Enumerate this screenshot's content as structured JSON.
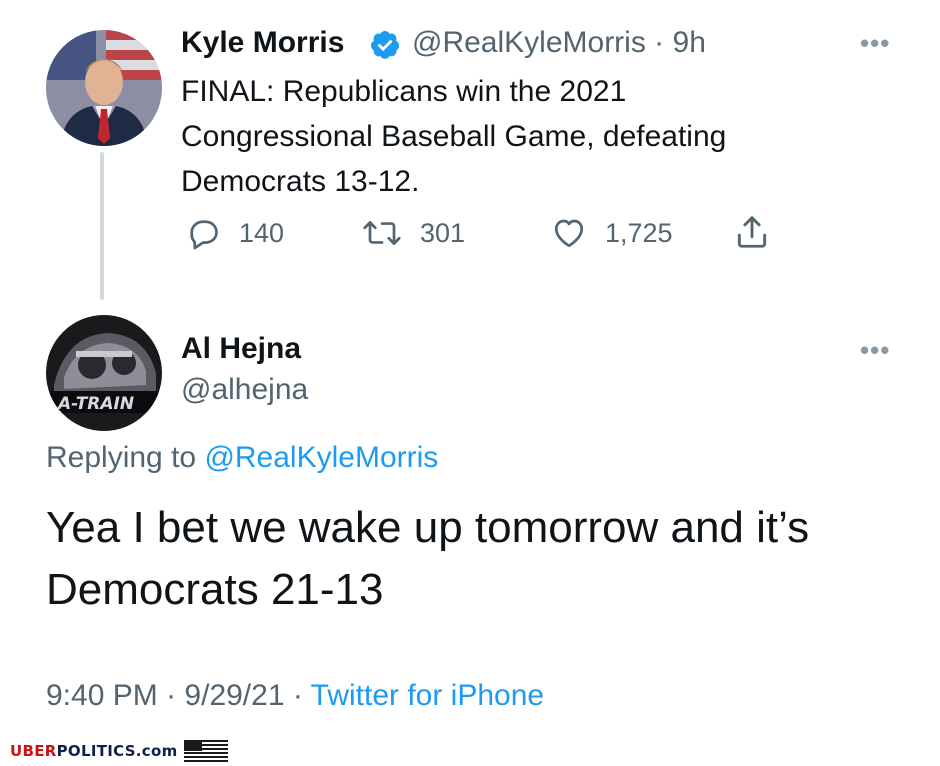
{
  "tweet": {
    "author_name": "Kyle Morris",
    "author_handle": "@RealKyleMorris",
    "time_separator": "·",
    "time_ago": "9h",
    "text_lines": [
      "FINAL: Republicans win the 2021",
      "Congressional Baseball Game, defeating",
      "Democrats 13-12."
    ],
    "replies": "140",
    "retweets": "301",
    "likes": "1,725",
    "more_icon": "ellipsis-icon"
  },
  "reply": {
    "author_name": "Al Hejna",
    "author_handle": "@alhejna",
    "replying_to_label": "Replying to",
    "replying_to_handle": "@RealKyleMorris",
    "text_lines": [
      "Yea I bet we wake up tomorrow and it’s",
      "Democrats 21-13"
    ],
    "time": "9:40 PM",
    "separator": "·",
    "date": "9/29/21",
    "source": "Twitter for iPhone",
    "avatar_text": "A-TRAIN"
  },
  "footer": {
    "brand_red": "UBER",
    "brand_blue": "POLITICS.com"
  },
  "colors": {
    "text": "#0f1419",
    "secondary": "#536471",
    "link": "#1d9bf0",
    "verified": "#1d9bf0",
    "thread_line": "#cfd9de"
  }
}
